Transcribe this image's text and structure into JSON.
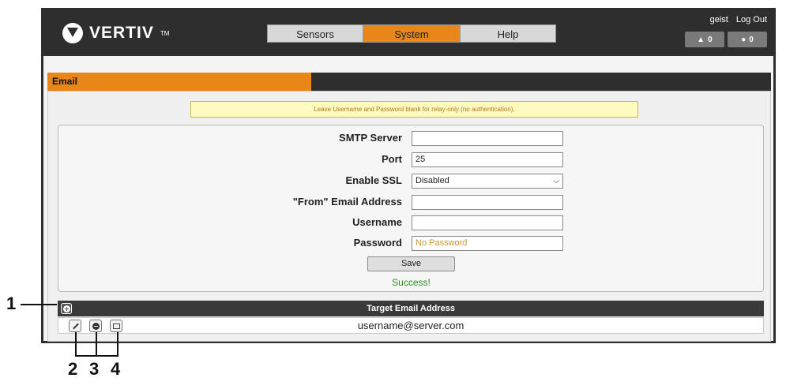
{
  "brand": {
    "name": "VERTIV",
    "tm": "TM"
  },
  "nav": {
    "tabs": [
      {
        "label": "Sensors",
        "active": false
      },
      {
        "label": "System",
        "active": true
      },
      {
        "label": "Help",
        "active": false
      }
    ]
  },
  "user": {
    "name": "geist",
    "logout_label": "Log Out"
  },
  "badges": {
    "alarms": {
      "icon": "warning-icon",
      "count": "0"
    },
    "warnings": {
      "icon": "info-icon",
      "count": "0"
    }
  },
  "panel": {
    "tab_label": "Email",
    "notice": "Leave Username and Password blank for relay-only (no authentication).",
    "fields": {
      "smtp_server": {
        "label": "SMTP Server",
        "value": ""
      },
      "port": {
        "label": "Port",
        "value": "25"
      },
      "enable_ssl": {
        "label": "Enable SSL",
        "value": "Disabled"
      },
      "from_address": {
        "label": "\"From\" Email Address",
        "value": ""
      },
      "username": {
        "label": "Username",
        "value": ""
      },
      "password": {
        "label": "Password",
        "placeholder": "No Password"
      }
    },
    "save_label": "Save",
    "status": "Success!",
    "targets": {
      "header": "Target Email Address",
      "rows": [
        {
          "email": "username@server.com"
        }
      ]
    }
  },
  "callouts": [
    "1",
    "2",
    "3",
    "4"
  ],
  "colors": {
    "accent": "#e8861a",
    "dark": "#2e2e2e",
    "success": "#2b8a1e",
    "notice_bg": "#fff9c2"
  }
}
